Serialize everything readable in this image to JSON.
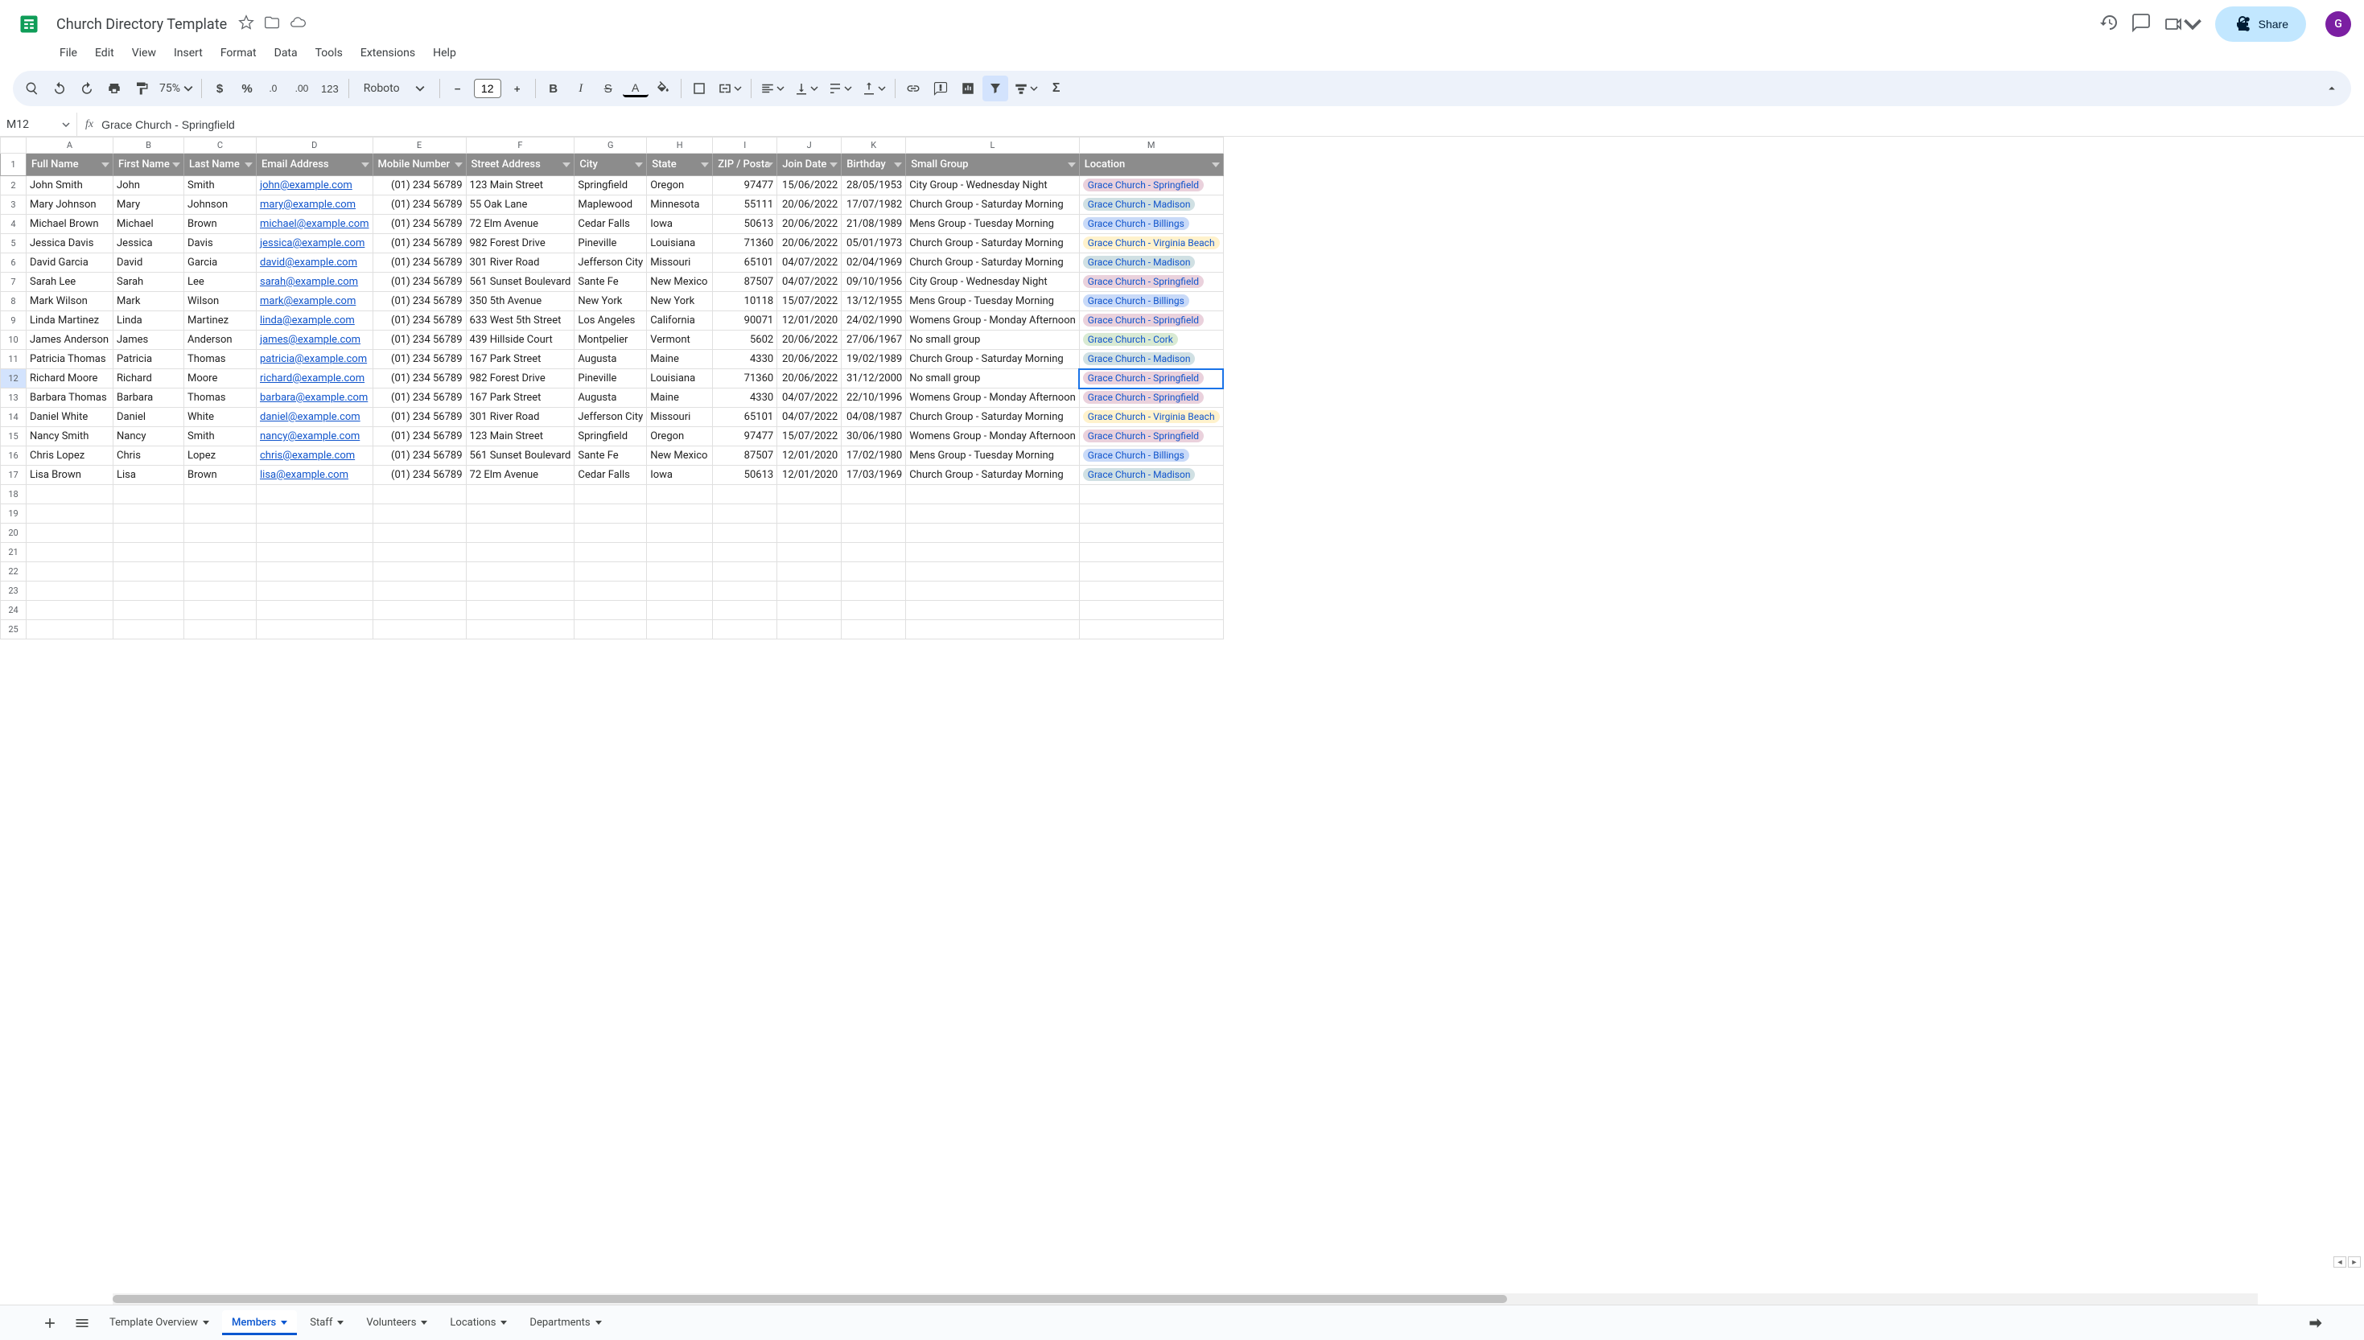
{
  "doc": {
    "title": "Church Directory Template"
  },
  "menus": [
    "File",
    "Edit",
    "View",
    "Insert",
    "Format",
    "Data",
    "Tools",
    "Extensions",
    "Help"
  ],
  "share_label": "Share",
  "avatar_letter": "G",
  "toolbar": {
    "zoom": "75%",
    "font_name": "Roboto",
    "font_size": "12",
    "number_123": "123"
  },
  "namebox": {
    "ref": "M12",
    "formula": "Grace Church - Springfield"
  },
  "columns": [
    "A",
    "B",
    "C",
    "D",
    "E",
    "F",
    "G",
    "H",
    "I",
    "J",
    "K",
    "L",
    "M"
  ],
  "col_classes": [
    "col-A",
    "col-B",
    "col-C",
    "col-D",
    "col-E",
    "col-F",
    "col-G",
    "col-H",
    "col-I",
    "col-J",
    "col-K",
    "col-L",
    "col-M"
  ],
  "headers": [
    "Full Name",
    "First Name",
    "Last Name",
    "Email Address",
    "Mobile Number",
    "Street Address",
    "City",
    "State",
    "ZIP / Posta",
    "Join Date",
    "Birthday",
    "Small Group",
    "Location"
  ],
  "location_colors": {
    "Grace Church - Springfield": "loc-springfield",
    "Grace Church - Madison": "loc-madison",
    "Grace Church - Billings": "loc-billings",
    "Grace Church - Virginia Beach": "loc-virginia",
    "Grace Church - Cork": "loc-cork"
  },
  "rows": [
    {
      "full": "John Smith",
      "first": "John",
      "last": "Smith",
      "email": "john@example.com",
      "mobile": "(01) 234 56789",
      "street": "123 Main Street",
      "city": "Springfield",
      "state": "Oregon",
      "zip": "97477",
      "join": "15/06/2022",
      "bday": "28/05/1953",
      "group": "City Group - Wednesday Night",
      "loc": "Grace Church - Springfield"
    },
    {
      "full": "Mary Johnson",
      "first": "Mary",
      "last": "Johnson",
      "email": "mary@example.com",
      "mobile": "(01) 234 56789",
      "street": "55 Oak Lane",
      "city": "Maplewood",
      "state": "Minnesota",
      "zip": "55111",
      "join": "20/06/2022",
      "bday": "17/07/1982",
      "group": "Church Group - Saturday Morning",
      "loc": "Grace Church - Madison"
    },
    {
      "full": "Michael Brown",
      "first": "Michael",
      "last": "Brown",
      "email": "michael@example.com",
      "mobile": "(01) 234 56789",
      "street": "72 Elm Avenue",
      "city": "Cedar Falls",
      "state": "Iowa",
      "zip": "50613",
      "join": "20/06/2022",
      "bday": "21/08/1989",
      "group": "Mens Group - Tuesday Morning",
      "loc": "Grace Church - Billings"
    },
    {
      "full": "Jessica Davis",
      "first": "Jessica",
      "last": "Davis",
      "email": "jessica@example.com",
      "mobile": "(01) 234 56789",
      "street": "982 Forest Drive",
      "city": "Pineville",
      "state": "Louisiana",
      "zip": "71360",
      "join": "20/06/2022",
      "bday": "05/01/1973",
      "group": "Church Group - Saturday Morning",
      "loc": "Grace Church - Virginia Beach"
    },
    {
      "full": "David Garcia",
      "first": "David",
      "last": "Garcia",
      "email": "david@example.com",
      "mobile": "(01) 234 56789",
      "street": "301 River Road",
      "city": "Jefferson City",
      "state": "Missouri",
      "zip": "65101",
      "join": "04/07/2022",
      "bday": "02/04/1969",
      "group": "Church Group - Saturday Morning",
      "loc": "Grace Church - Madison"
    },
    {
      "full": "Sarah Lee",
      "first": "Sarah",
      "last": "Lee",
      "email": "sarah@example.com",
      "mobile": "(01) 234 56789",
      "street": "561 Sunset Boulevard",
      "city": "Sante Fe",
      "state": "New Mexico",
      "zip": "87507",
      "join": "04/07/2022",
      "bday": "09/10/1956",
      "group": "City Group - Wednesday Night",
      "loc": "Grace Church - Springfield"
    },
    {
      "full": "Mark Wilson",
      "first": "Mark",
      "last": "Wilson",
      "email": "mark@example.com",
      "mobile": "(01) 234 56789",
      "street": "350 5th Avenue",
      "city": "New York",
      "state": "New York",
      "zip": "10118",
      "join": "15/07/2022",
      "bday": "13/12/1955",
      "group": "Mens Group - Tuesday Morning",
      "loc": "Grace Church - Billings"
    },
    {
      "full": "Linda Martinez",
      "first": "Linda",
      "last": "Martinez",
      "email": "linda@example.com",
      "mobile": "(01) 234 56789",
      "street": "633 West 5th Street",
      "city": "Los Angeles",
      "state": "California",
      "zip": "90071",
      "join": "12/01/2020",
      "bday": "24/02/1990",
      "group": "Womens Group - Monday Afternoon",
      "loc": "Grace Church - Springfield"
    },
    {
      "full": "James Anderson",
      "first": "James",
      "last": "Anderson",
      "email": "james@example.com",
      "mobile": "(01) 234 56789",
      "street": "439 Hillside Court",
      "city": "Montpelier",
      "state": "Vermont",
      "zip": "5602",
      "join": "20/06/2022",
      "bday": "27/06/1967",
      "group": "No small group",
      "loc": "Grace Church - Cork"
    },
    {
      "full": "Patricia Thomas",
      "first": "Patricia",
      "last": "Thomas",
      "email": "patricia@example.com",
      "mobile": "(01) 234 56789",
      "street": "167 Park Street",
      "city": "Augusta",
      "state": "Maine",
      "zip": "4330",
      "join": "20/06/2022",
      "bday": "19/02/1989",
      "group": "Church Group - Saturday Morning",
      "loc": "Grace Church - Madison"
    },
    {
      "full": "Richard Moore",
      "first": "Richard",
      "last": "Moore",
      "email": "richard@example.com",
      "mobile": "(01) 234 56789",
      "street": "982 Forest Drive",
      "city": "Pineville",
      "state": "Louisiana",
      "zip": "71360",
      "join": "20/06/2022",
      "bday": "31/12/2000",
      "group": "No small group",
      "loc": "Grace Church - Springfield"
    },
    {
      "full": "Barbara Thomas",
      "first": "Barbara",
      "last": "Thomas",
      "email": "barbara@example.com",
      "mobile": "(01) 234 56789",
      "street": "167 Park Street",
      "city": "Augusta",
      "state": "Maine",
      "zip": "4330",
      "join": "04/07/2022",
      "bday": "22/10/1996",
      "group": "Womens Group - Monday Afternoon",
      "loc": "Grace Church - Springfield"
    },
    {
      "full": "Daniel White",
      "first": "Daniel",
      "last": "White",
      "email": "daniel@example.com",
      "mobile": "(01) 234 56789",
      "street": "301 River Road",
      "city": "Jefferson City",
      "state": "Missouri",
      "zip": "65101",
      "join": "04/07/2022",
      "bday": "04/08/1987",
      "group": "Church Group - Saturday Morning",
      "loc": "Grace Church - Virginia Beach"
    },
    {
      "full": "Nancy Smith",
      "first": "Nancy",
      "last": "Smith",
      "email": "nancy@example.com",
      "mobile": "(01) 234 56789",
      "street": "123 Main Street",
      "city": "Springfield",
      "state": "Oregon",
      "zip": "97477",
      "join": "15/07/2022",
      "bday": "30/06/1980",
      "group": "Womens Group - Monday Afternoon",
      "loc": "Grace Church - Springfield"
    },
    {
      "full": "Chris Lopez",
      "first": "Chris",
      "last": "Lopez",
      "email": "chris@example.com",
      "mobile": "(01) 234 56789",
      "street": "561 Sunset Boulevard",
      "city": "Sante Fe",
      "state": "New Mexico",
      "zip": "87507",
      "join": "12/01/2020",
      "bday": "17/02/1980",
      "group": "Mens Group - Tuesday Morning",
      "loc": "Grace Church - Billings"
    },
    {
      "full": "Lisa Brown",
      "first": "Lisa",
      "last": "Brown",
      "email": "lisa@example.com",
      "mobile": "(01) 234 56789",
      "street": "72 Elm Avenue",
      "city": "Cedar Falls",
      "state": "Iowa",
      "zip": "50613",
      "join": "12/01/2020",
      "bday": "17/03/1969",
      "group": "Church Group - Saturday Morning",
      "loc": "Grace Church - Madison"
    }
  ],
  "empty_rows": [
    18,
    19,
    20,
    21,
    22,
    23,
    24,
    25
  ],
  "active_row_index": 11,
  "sheets": [
    {
      "name": "Template Overview",
      "active": false
    },
    {
      "name": "Members",
      "active": true
    },
    {
      "name": "Staff",
      "active": false
    },
    {
      "name": "Volunteers",
      "active": false
    },
    {
      "name": "Locations",
      "active": false
    },
    {
      "name": "Departments",
      "active": false
    }
  ]
}
